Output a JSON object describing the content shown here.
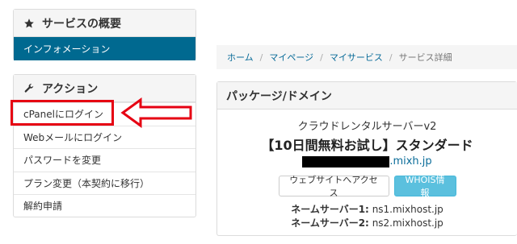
{
  "sidebar": {
    "overview": {
      "title": "サービスの概要",
      "active_item": "インフォメーション"
    },
    "actions": {
      "title": "アクション",
      "items": [
        "cPanelにログイン",
        "Webメールにログイン",
        "パスワードを変更",
        "プラン変更（本契約に移行）",
        "解約申請"
      ]
    }
  },
  "breadcrumb": {
    "items": [
      "ホーム",
      "マイページ",
      "マイサービス"
    ],
    "current": "サービス詳細"
  },
  "package": {
    "title": "パッケージ/ドメイン",
    "product_name": "クラウドレンタルサーバーv2",
    "plan_name": "【10日間無料お試し】スタンダード",
    "domain_suffix": ".mixh.jp",
    "visit_button": "ウェブサイトへアクセス",
    "whois_button": "WHOIS情報",
    "nameservers": [
      {
        "label": "ネームサーバー1:",
        "value": "ns1.mixhost.jp"
      },
      {
        "label": "ネームサーバー2:",
        "value": "ns2.mixhost.jp"
      }
    ]
  },
  "colors": {
    "active_bg": "#006990",
    "highlight": "#e60012",
    "info_button": "#5bc0de",
    "link": "#0a6c99"
  },
  "icons": {
    "overview": "star-icon",
    "actions": "wrench-icon",
    "pointer": "left-arrow-icon"
  }
}
